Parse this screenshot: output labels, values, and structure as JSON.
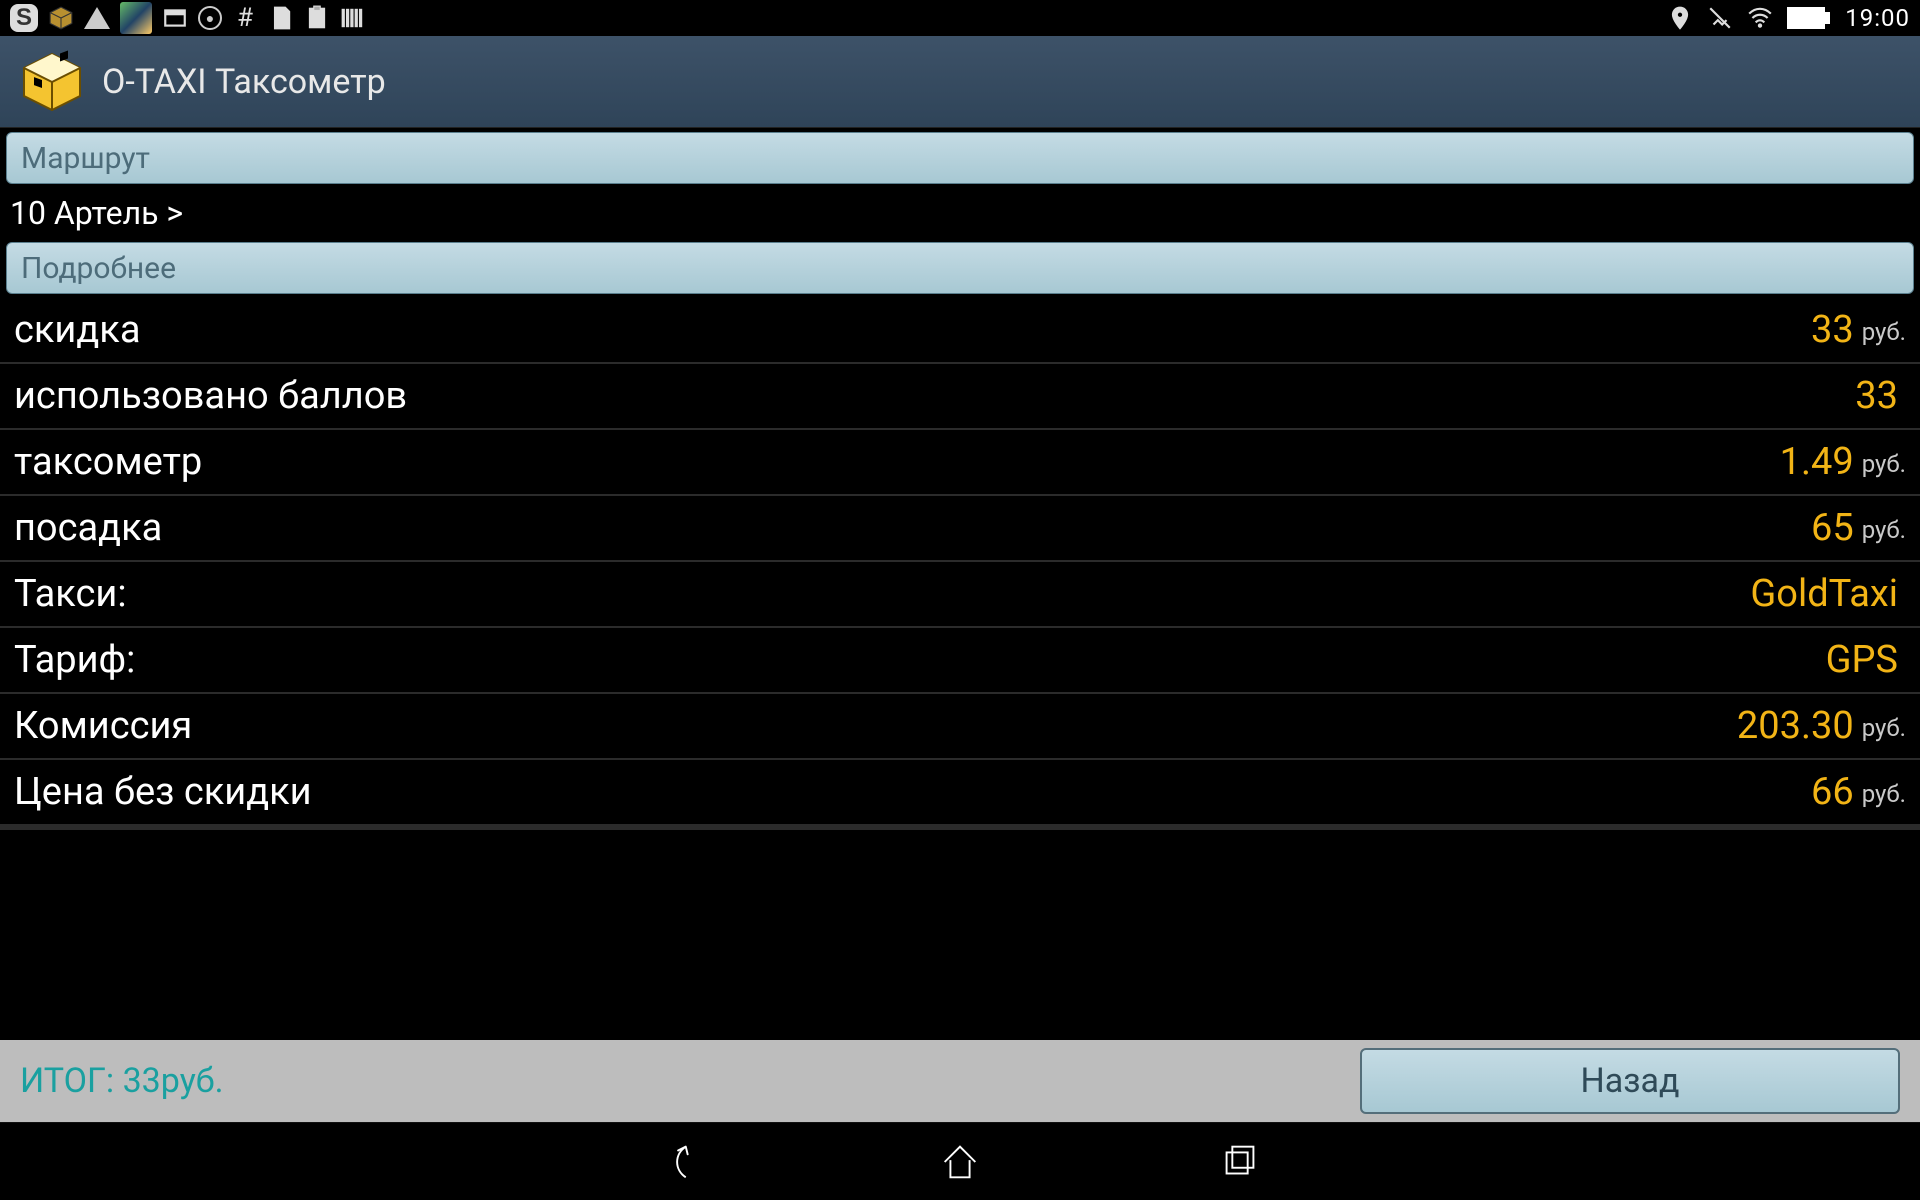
{
  "status": {
    "time": "19:00",
    "icons_left": [
      "skype",
      "cube",
      "warning",
      "thumb",
      "window",
      "lock-circle",
      "hash",
      "sd-card",
      "clipboard",
      "barcode"
    ],
    "icons_right": [
      "location",
      "vibrate",
      "wifi",
      "battery"
    ]
  },
  "appbar": {
    "title": "O-TAXI Таксометр"
  },
  "sections": {
    "route_header": "Маршрут",
    "details_header": "Подробнее"
  },
  "breadcrumb": "10 Артель  >",
  "rows": [
    {
      "label": "скидка",
      "value": "33",
      "unit": "руб."
    },
    {
      "label": "использовано баллов",
      "value": "33",
      "unit": ""
    },
    {
      "label": "таксометр",
      "value": "1.49",
      "unit": "руб."
    },
    {
      "label": "посадка",
      "value": "65",
      "unit": "руб."
    },
    {
      "label": "Такси:",
      "value": "GoldTaxi",
      "unit": ""
    },
    {
      "label": "Тариф:",
      "value": "GPS",
      "unit": ""
    },
    {
      "label": "Комиссия",
      "value": "203.30",
      "unit": "руб."
    },
    {
      "label": "Цена без скидки",
      "value": "66",
      "unit": "руб."
    }
  ],
  "footer": {
    "total_label": "ИТОГ: 33руб.",
    "back_label": "Назад"
  }
}
